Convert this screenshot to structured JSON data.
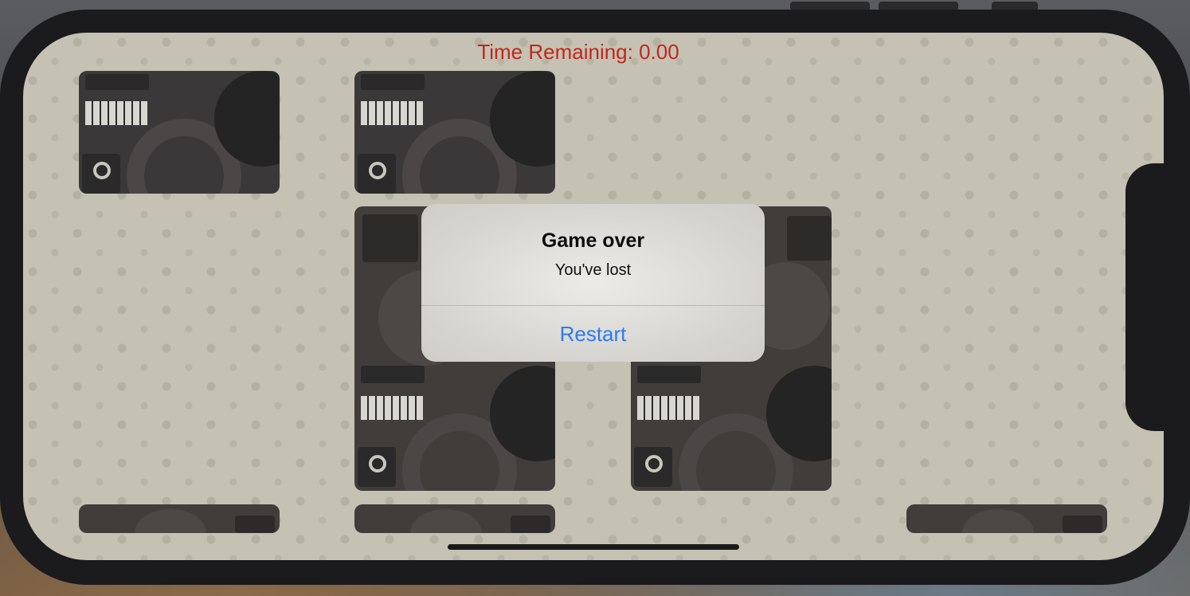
{
  "game": {
    "timer_label": "Time Remaining: 0.00",
    "timer_color": "#c0281c",
    "card_back_color": "#3a3838",
    "tiles_shown": 8
  },
  "alert": {
    "title": "Game over",
    "message": "You've lost",
    "button_label": "Restart",
    "button_color": "#2c7bf0"
  }
}
